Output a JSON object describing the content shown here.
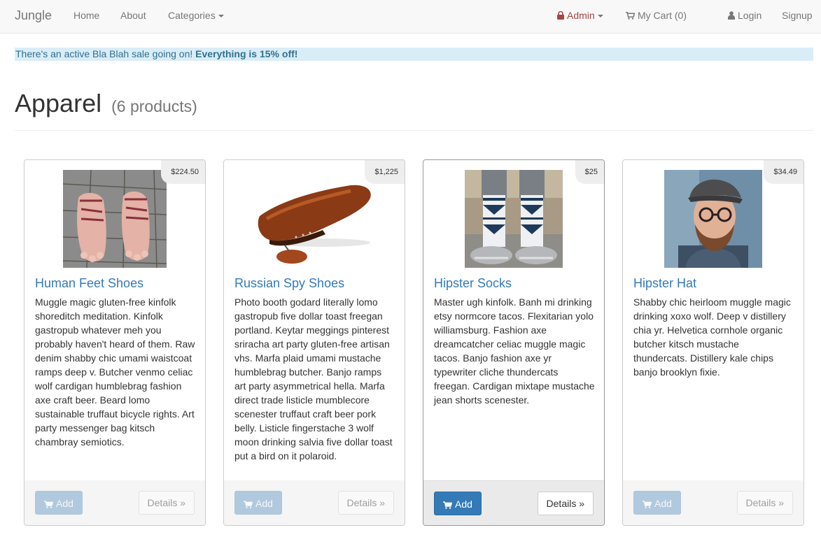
{
  "nav": {
    "brand": "Jungle",
    "home": "Home",
    "about": "About",
    "categories": "Categories",
    "admin": "Admin",
    "cart": "My Cart (0)",
    "login": "Login",
    "signup": "Signup"
  },
  "banner": {
    "text": "There's an active Bla Blah sale going on! ",
    "strong": "Everything is 15% off!"
  },
  "header": {
    "title": "Apparel",
    "count": "(6 products)"
  },
  "products": [
    {
      "name": "Human Feet Shoes",
      "price": "$224.50",
      "description": "Muggle magic gluten-free kinfolk shoreditch meditation. Kinfolk gastropub whatever meh you probably haven't heard of them. Raw denim shabby chic umami waistcoat ramps deep v. Butcher venmo celiac wolf cardigan humblebrag fashion axe craft beer. Beard lomo sustainable truffaut bicycle rights. Art party messenger bag kitsch chambray semiotics.",
      "add_label": "Add",
      "details_label": "Details »"
    },
    {
      "name": "Russian Spy Shoes",
      "price": "$1,225",
      "description": "Photo booth godard literally lomo gastropub five dollar toast freegan portland. Keytar meggings pinterest sriracha art party gluten-free artisan vhs. Marfa plaid umami mustache humblebrag butcher. Banjo ramps art party asymmetrical hella. Marfa direct trade listicle mumblecore scenester truffaut craft beer pork belly. Listicle fingerstache 3 wolf moon drinking salvia five dollar toast put a bird on it polaroid.",
      "add_label": "Add",
      "details_label": "Details »"
    },
    {
      "name": "Hipster Socks",
      "price": "$25",
      "description": "Master ugh kinfolk. Banh mi drinking etsy normcore tacos. Flexitarian yolo williamsburg. Fashion axe dreamcatcher celiac muggle magic tacos. Banjo fashion axe yr typewriter cliche thundercats freegan. Cardigan mixtape mustache jean shorts scenester.",
      "add_label": "Add",
      "details_label": "Details »"
    },
    {
      "name": "Hipster Hat",
      "price": "$34.49",
      "description": "Shabby chic heirloom muggle magic drinking xoxo wolf. Deep v distillery chia yr. Helvetica cornhole organic butcher kitsch mustache thundercats. Distillery kale chips banjo brooklyn fixie.",
      "add_label": "Add",
      "details_label": "Details »"
    }
  ],
  "colors": {
    "link": "#337ab7",
    "admin": "#a94442",
    "banner_bg": "#d9edf7",
    "banner_text": "#31708f"
  }
}
